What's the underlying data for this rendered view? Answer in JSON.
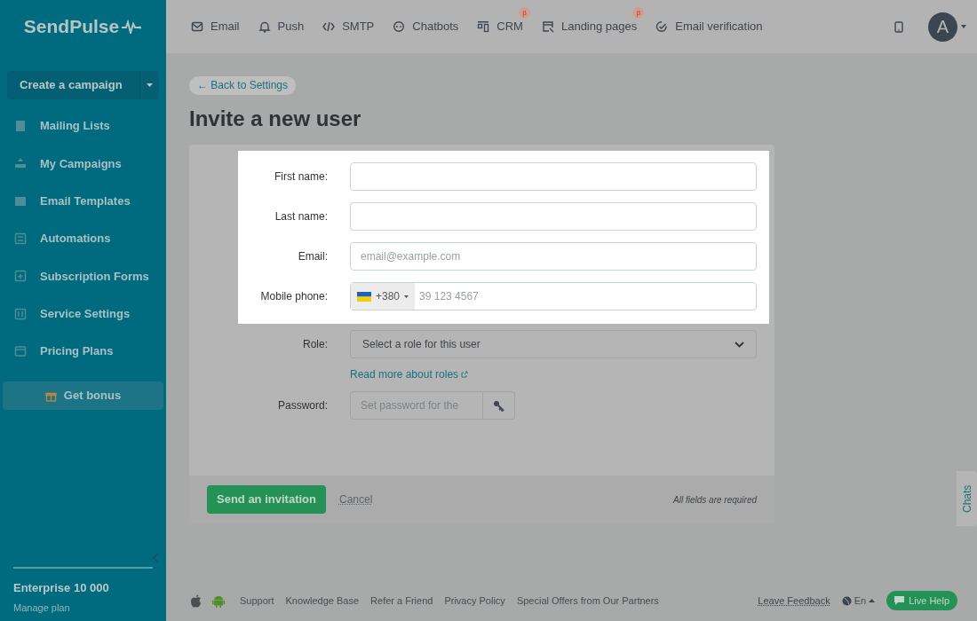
{
  "logo": {
    "text": "SendPulse"
  },
  "top_nav": [
    {
      "label": "Email"
    },
    {
      "label": "Push"
    },
    {
      "label": "SMTP"
    },
    {
      "label": "Chatbots"
    },
    {
      "label": "CRM",
      "badge": "β"
    },
    {
      "label": "Landing pages",
      "badge": "β"
    },
    {
      "label": "Email verification"
    }
  ],
  "avatar": {
    "initial": "A"
  },
  "sidebar": {
    "create_button": "Create a campaign",
    "items": [
      {
        "label": "Mailing Lists"
      },
      {
        "label": "My Campaigns"
      },
      {
        "label": "Email Templates"
      },
      {
        "label": "Automations"
      },
      {
        "label": "Subscription Forms"
      },
      {
        "label": "Service Settings"
      },
      {
        "label": "Pricing Plans"
      }
    ],
    "bonus_button": "Get bonus",
    "plan": "Enterprise 10 000",
    "manage_link": "Manage plan"
  },
  "back_link": "← Back to Settings",
  "page_title": "Invite a new user",
  "form": {
    "fields": [
      {
        "kind": "text",
        "label": "First name:",
        "highlighted": true
      },
      {
        "kind": "text",
        "label": "Last name:",
        "highlighted": true
      },
      {
        "kind": "text",
        "label": "Email:",
        "placeholder": "email@example.com",
        "highlighted": true
      },
      {
        "kind": "phone",
        "label": "Mobile phone:",
        "code": "+380",
        "placeholder": "39 123 4567",
        "highlighted": true
      },
      {
        "kind": "select",
        "label": "Role:",
        "value": "Select a role for this user",
        "link": "Read more about roles",
        "highlighted": false
      },
      {
        "kind": "password",
        "label": "Password:",
        "placeholder": "Set password for the",
        "highlighted": false
      }
    ],
    "submit": "Send an invitation",
    "cancel": "Cancel",
    "note": "All fields are required"
  },
  "footer": {
    "links": [
      "Support",
      "Knowledge Base",
      "Refer a Friend",
      "Privacy Policy",
      "Special Offers from Our Partners"
    ],
    "feedback": "Leave Feedback",
    "language": "En",
    "live_help": "Live Help"
  },
  "chats_tab": "Chats"
}
